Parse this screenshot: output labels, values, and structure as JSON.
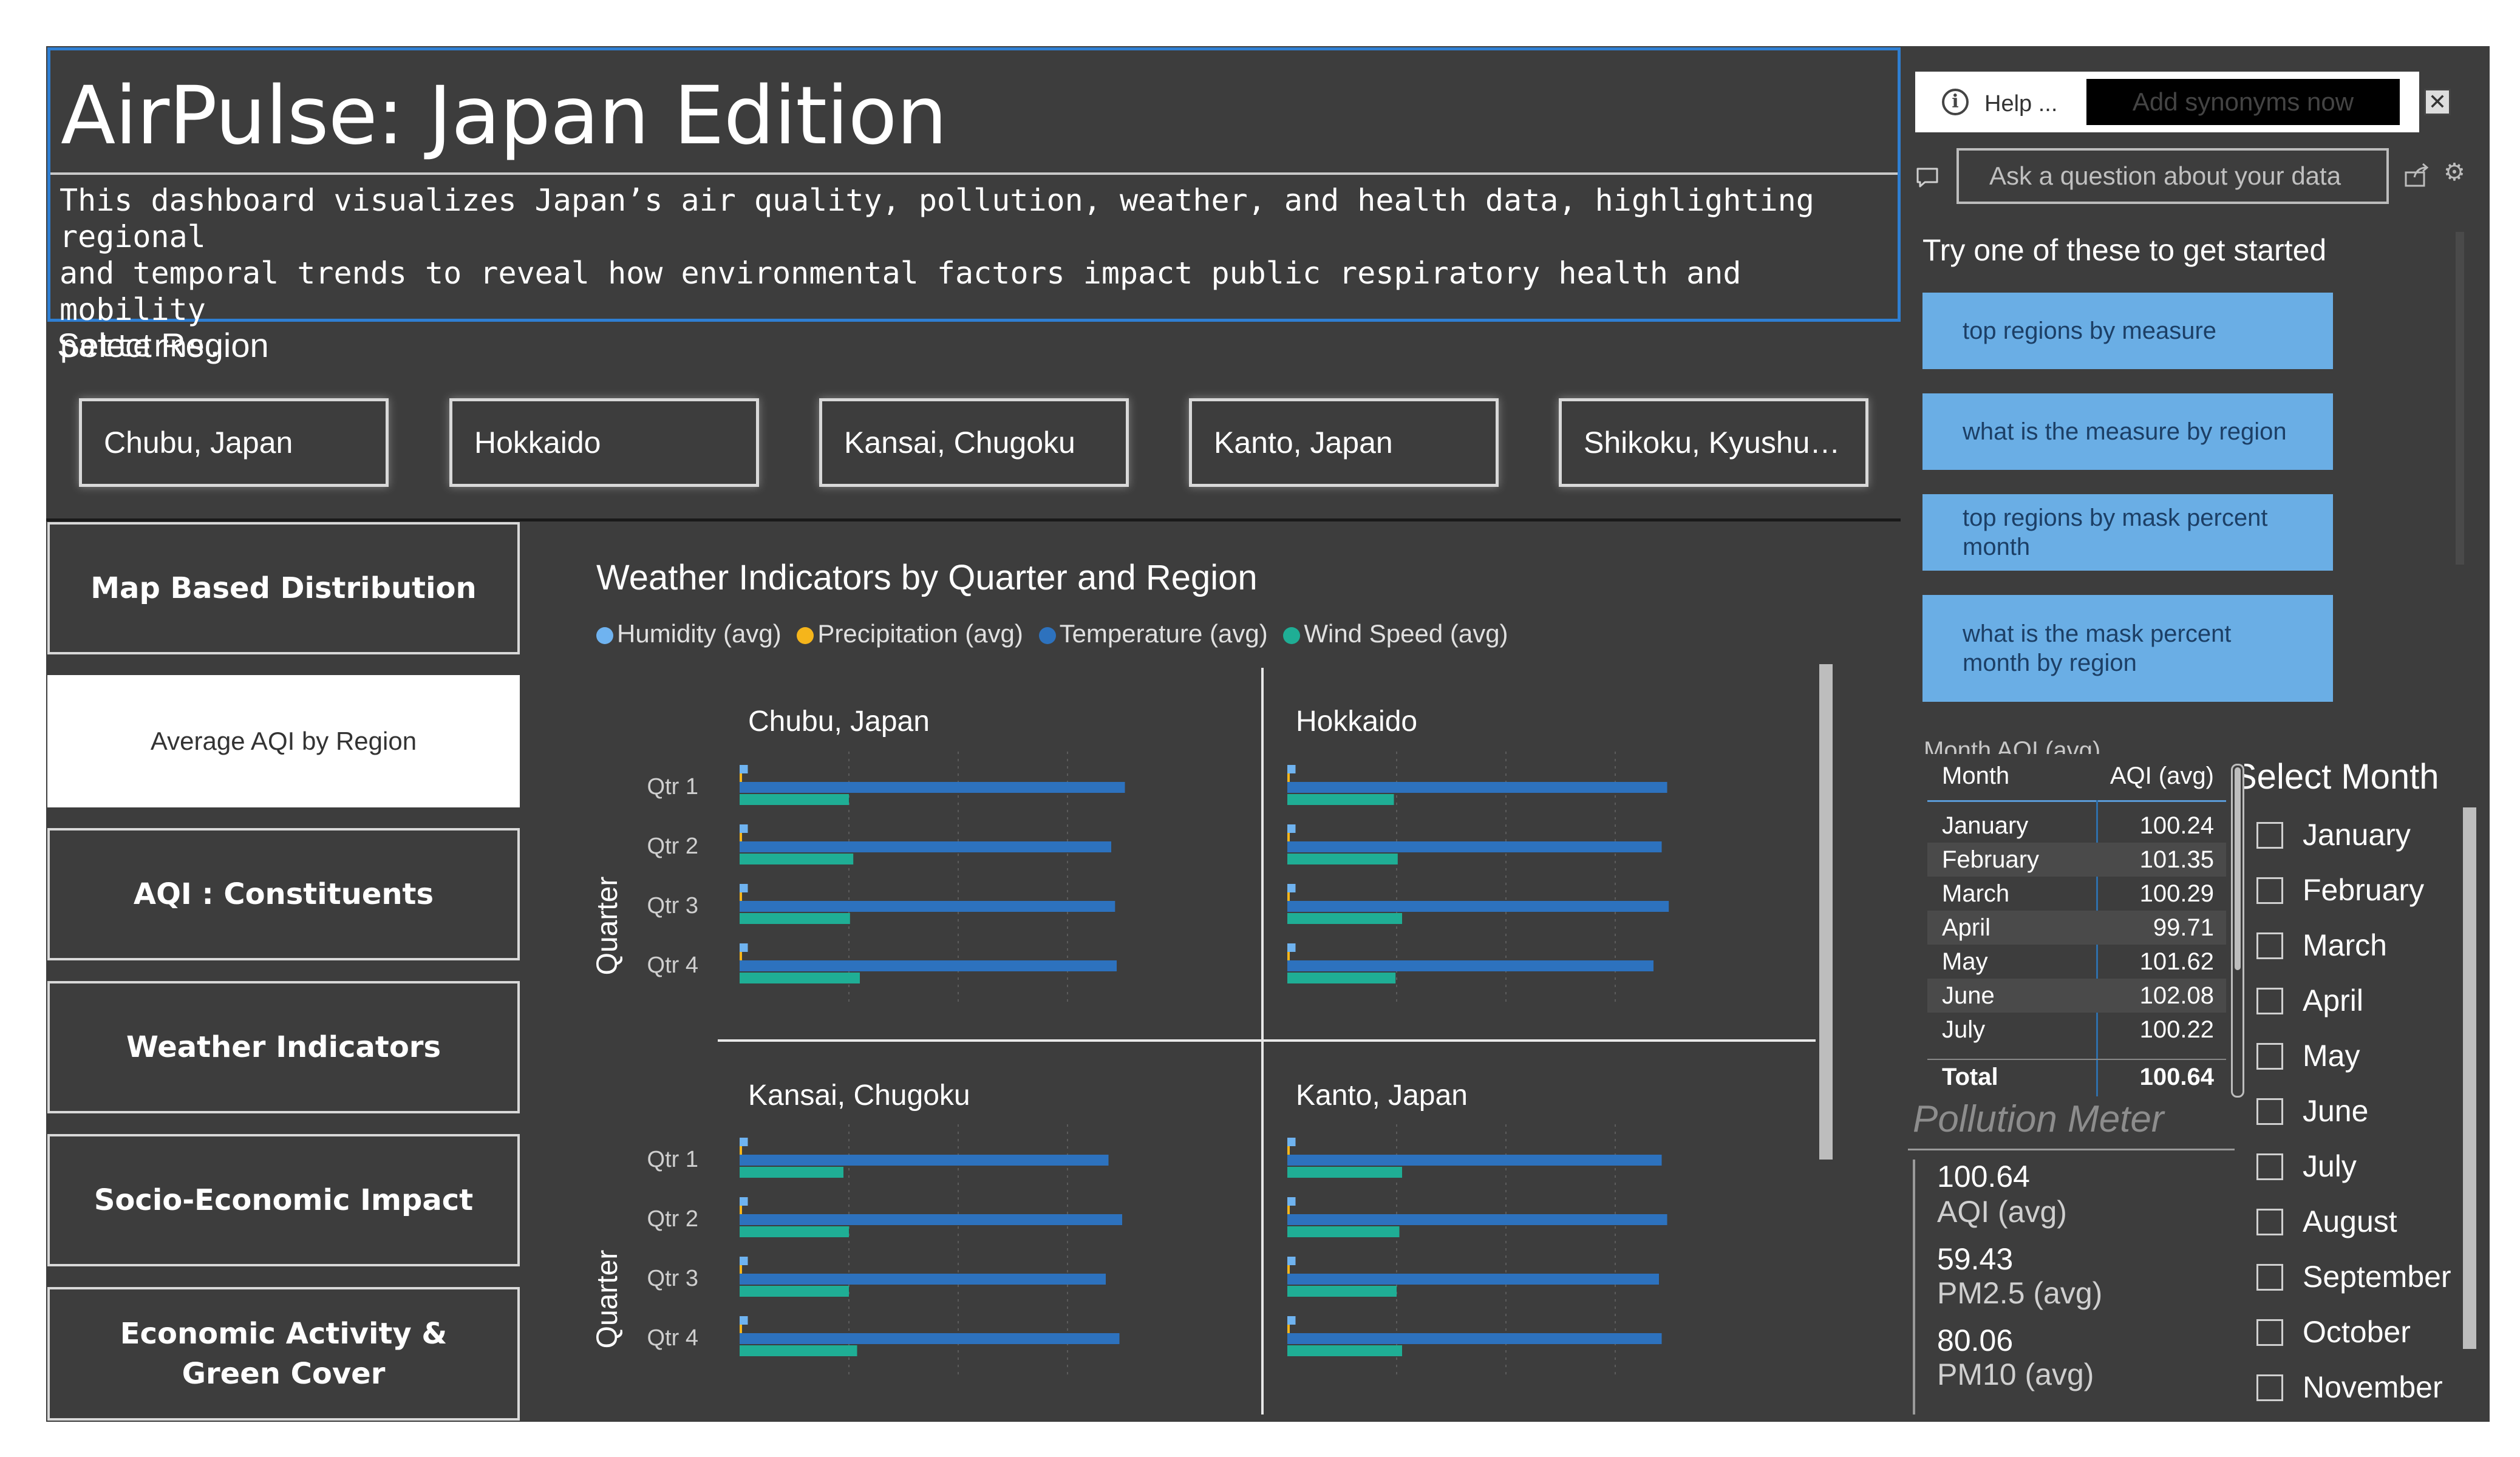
{
  "header": {
    "title": "AirPulse: Japan Edition",
    "description": "This dashboard visualizes Japan’s air quality, pollution, weather, and health data, highlighting regional\nand temporal trends to reveal how environmental factors impact public respiratory health and mobility\npatterns."
  },
  "region_slicer": {
    "label": "Select Region",
    "options": [
      "Chubu, Japan",
      "Hokkaido",
      "Kansai, Chugoku",
      "Kanto, Japan",
      "Shikoku, Kyushu…"
    ]
  },
  "nav": {
    "items": [
      {
        "label": "Map Based Distribution",
        "active": false
      },
      {
        "label": "Average AQI by Region",
        "active": true
      },
      {
        "label": "AQI : Constituents",
        "active": false
      },
      {
        "label": "Weather Indicators",
        "active": false
      },
      {
        "label": "Socio-Economic Impact",
        "active": false
      },
      {
        "label": "Economic Activity & Green Cover",
        "active": false
      }
    ]
  },
  "chart_data": {
    "type": "bar",
    "orientation": "horizontal",
    "title": "Weather Indicators by Quarter and Region",
    "ylabel": "Quarter",
    "categories": [
      "Qtr 1",
      "Qtr 2",
      "Qtr 3",
      "Qtr 4"
    ],
    "legend": [
      "Humidity (avg)",
      "Precipitation (avg)",
      "Temperature (avg)",
      "Wind Speed (avg)"
    ],
    "colors": {
      "Humidity (avg)": "#6fb3f0",
      "Precipitation (avg)": "#f5b51b",
      "Temperature (avg)": "#2d72be",
      "Wind Speed (avg)": "#1fae95"
    },
    "xlim": [
      0,
      80
    ],
    "grid": true,
    "panels": [
      {
        "name": "Chubu, Japan",
        "series": [
          {
            "name": "Humidity (avg)",
            "values": [
              1.5,
              1.5,
              1.5,
              1.5
            ]
          },
          {
            "name": "Precipitation (avg)",
            "values": [
              0.4,
              0.4,
              0.4,
              0.4
            ]
          },
          {
            "name": "Temperature (avg)",
            "values": [
              70.5,
              68.0,
              68.7,
              69.0
            ]
          },
          {
            "name": "Wind Speed (avg)",
            "values": [
              20.0,
              20.8,
              20.2,
              22.0
            ]
          }
        ]
      },
      {
        "name": "Hokkaido",
        "series": [
          {
            "name": "Humidity (avg)",
            "values": [
              1.5,
              1.5,
              1.5,
              1.5
            ]
          },
          {
            "name": "Precipitation (avg)",
            "values": [
              0.4,
              0.4,
              0.4,
              0.4
            ]
          },
          {
            "name": "Temperature (avg)",
            "values": [
              69.5,
              68.5,
              69.8,
              67.0
            ]
          },
          {
            "name": "Wind Speed (avg)",
            "values": [
              19.5,
              20.2,
              21.0,
              19.8
            ]
          }
        ]
      },
      {
        "name": "Kansai, Chugoku",
        "series": [
          {
            "name": "Humidity (avg)",
            "values": [
              1.5,
              1.5,
              1.5,
              1.5
            ]
          },
          {
            "name": "Precipitation (avg)",
            "values": [
              0.4,
              0.4,
              0.4,
              0.4
            ]
          },
          {
            "name": "Temperature (avg)",
            "values": [
              67.5,
              70.0,
              67.0,
              69.5
            ]
          },
          {
            "name": "Wind Speed (avg)",
            "values": [
              19.0,
              20.0,
              20.0,
              21.5
            ]
          }
        ]
      },
      {
        "name": "Kanto, Japan",
        "series": [
          {
            "name": "Humidity (avg)",
            "values": [
              1.5,
              1.5,
              1.5,
              1.5
            ]
          },
          {
            "name": "Precipitation (avg)",
            "values": [
              0.4,
              0.4,
              0.4,
              0.4
            ]
          },
          {
            "name": "Temperature (avg)",
            "values": [
              68.5,
              69.5,
              68.0,
              68.5
            ]
          },
          {
            "name": "Wind Speed (avg)",
            "values": [
              21.0,
              20.5,
              20.0,
              21.0
            ]
          }
        ]
      }
    ]
  },
  "qa": {
    "help_label": "Help ...",
    "synonyms_button": "Add synonyms now",
    "info_glyph": "i",
    "close_glyph": "✕",
    "gear_glyph": "⚙",
    "input_placeholder": "Ask a question about your data",
    "try_label": "Try one of these to get started",
    "suggestions": [
      "top regions by measure",
      "what is the measure by region",
      "top regions by mask percent month",
      "what is the mask percent month by region"
    ],
    "icons": [
      "info-icon",
      "close-icon",
      "chat-icon",
      "share-icon",
      "gear-icon"
    ]
  },
  "month_table": {
    "ghost_header": "Month        AQI (avg)",
    "headers": [
      "Month",
      "AQI (avg)"
    ],
    "rows": [
      [
        "January",
        "100.24"
      ],
      [
        "February",
        "101.35"
      ],
      [
        "March",
        "100.29"
      ],
      [
        "April",
        "99.71"
      ],
      [
        "May",
        "101.62"
      ],
      [
        "June",
        "102.08"
      ],
      [
        "July",
        "100.22"
      ]
    ],
    "total": [
      "Total",
      "100.64"
    ]
  },
  "pollution_meter": {
    "title": "Pollution Meter",
    "kpis": [
      {
        "value": "100.64",
        "label": "AQI (avg)"
      },
      {
        "value": "59.43",
        "label": "PM2.5 (avg)"
      },
      {
        "value": "80.06",
        "label": "PM10 (avg)"
      }
    ]
  },
  "month_slicer": {
    "label": "Select Month",
    "options": [
      "January",
      "February",
      "March",
      "April",
      "May",
      "June",
      "July",
      "August",
      "September",
      "October",
      "November"
    ]
  }
}
